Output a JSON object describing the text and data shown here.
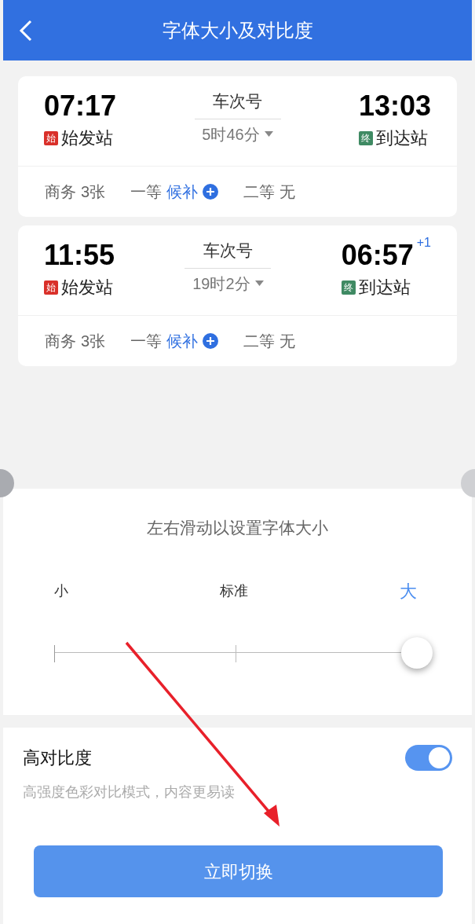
{
  "header": {
    "title": "字体大小及对比度"
  },
  "trains": [
    {
      "depart_time": "07:17",
      "depart_tag": "始",
      "depart_station": "始发站",
      "train_no": "车次号",
      "duration": "5时46分",
      "arrive_time": "13:03",
      "arrive_tag": "终",
      "arrive_station": "到达站",
      "seats": [
        {
          "kind": "count",
          "class": "商务",
          "status": "3张"
        },
        {
          "kind": "waitlist",
          "class": "一等",
          "status": "候补"
        },
        {
          "kind": "none",
          "class": "二等",
          "status": "无"
        }
      ]
    },
    {
      "depart_time": "11:55",
      "depart_tag": "始",
      "depart_station": "始发站",
      "train_no": "车次号",
      "duration": "19时2分",
      "arrive_time": "06:57",
      "day_offset": "+1",
      "arrive_tag": "终",
      "arrive_station": "到达站",
      "seats": [
        {
          "kind": "count",
          "class": "商务",
          "status": "3张"
        },
        {
          "kind": "waitlist",
          "class": "一等",
          "status": "候补"
        },
        {
          "kind": "none",
          "class": "二等",
          "status": "无"
        }
      ]
    }
  ],
  "font_size": {
    "hint": "左右滑动以设置字体大小",
    "stops": [
      {
        "label": "小",
        "selected": false
      },
      {
        "label": "标准",
        "selected": false
      },
      {
        "label": "大",
        "selected": true
      }
    ],
    "level": 1
  },
  "contrast": {
    "title": "高对比度",
    "description": "高强度色彩对比模式，内容更易读",
    "on": true
  },
  "button": "立即切换"
}
